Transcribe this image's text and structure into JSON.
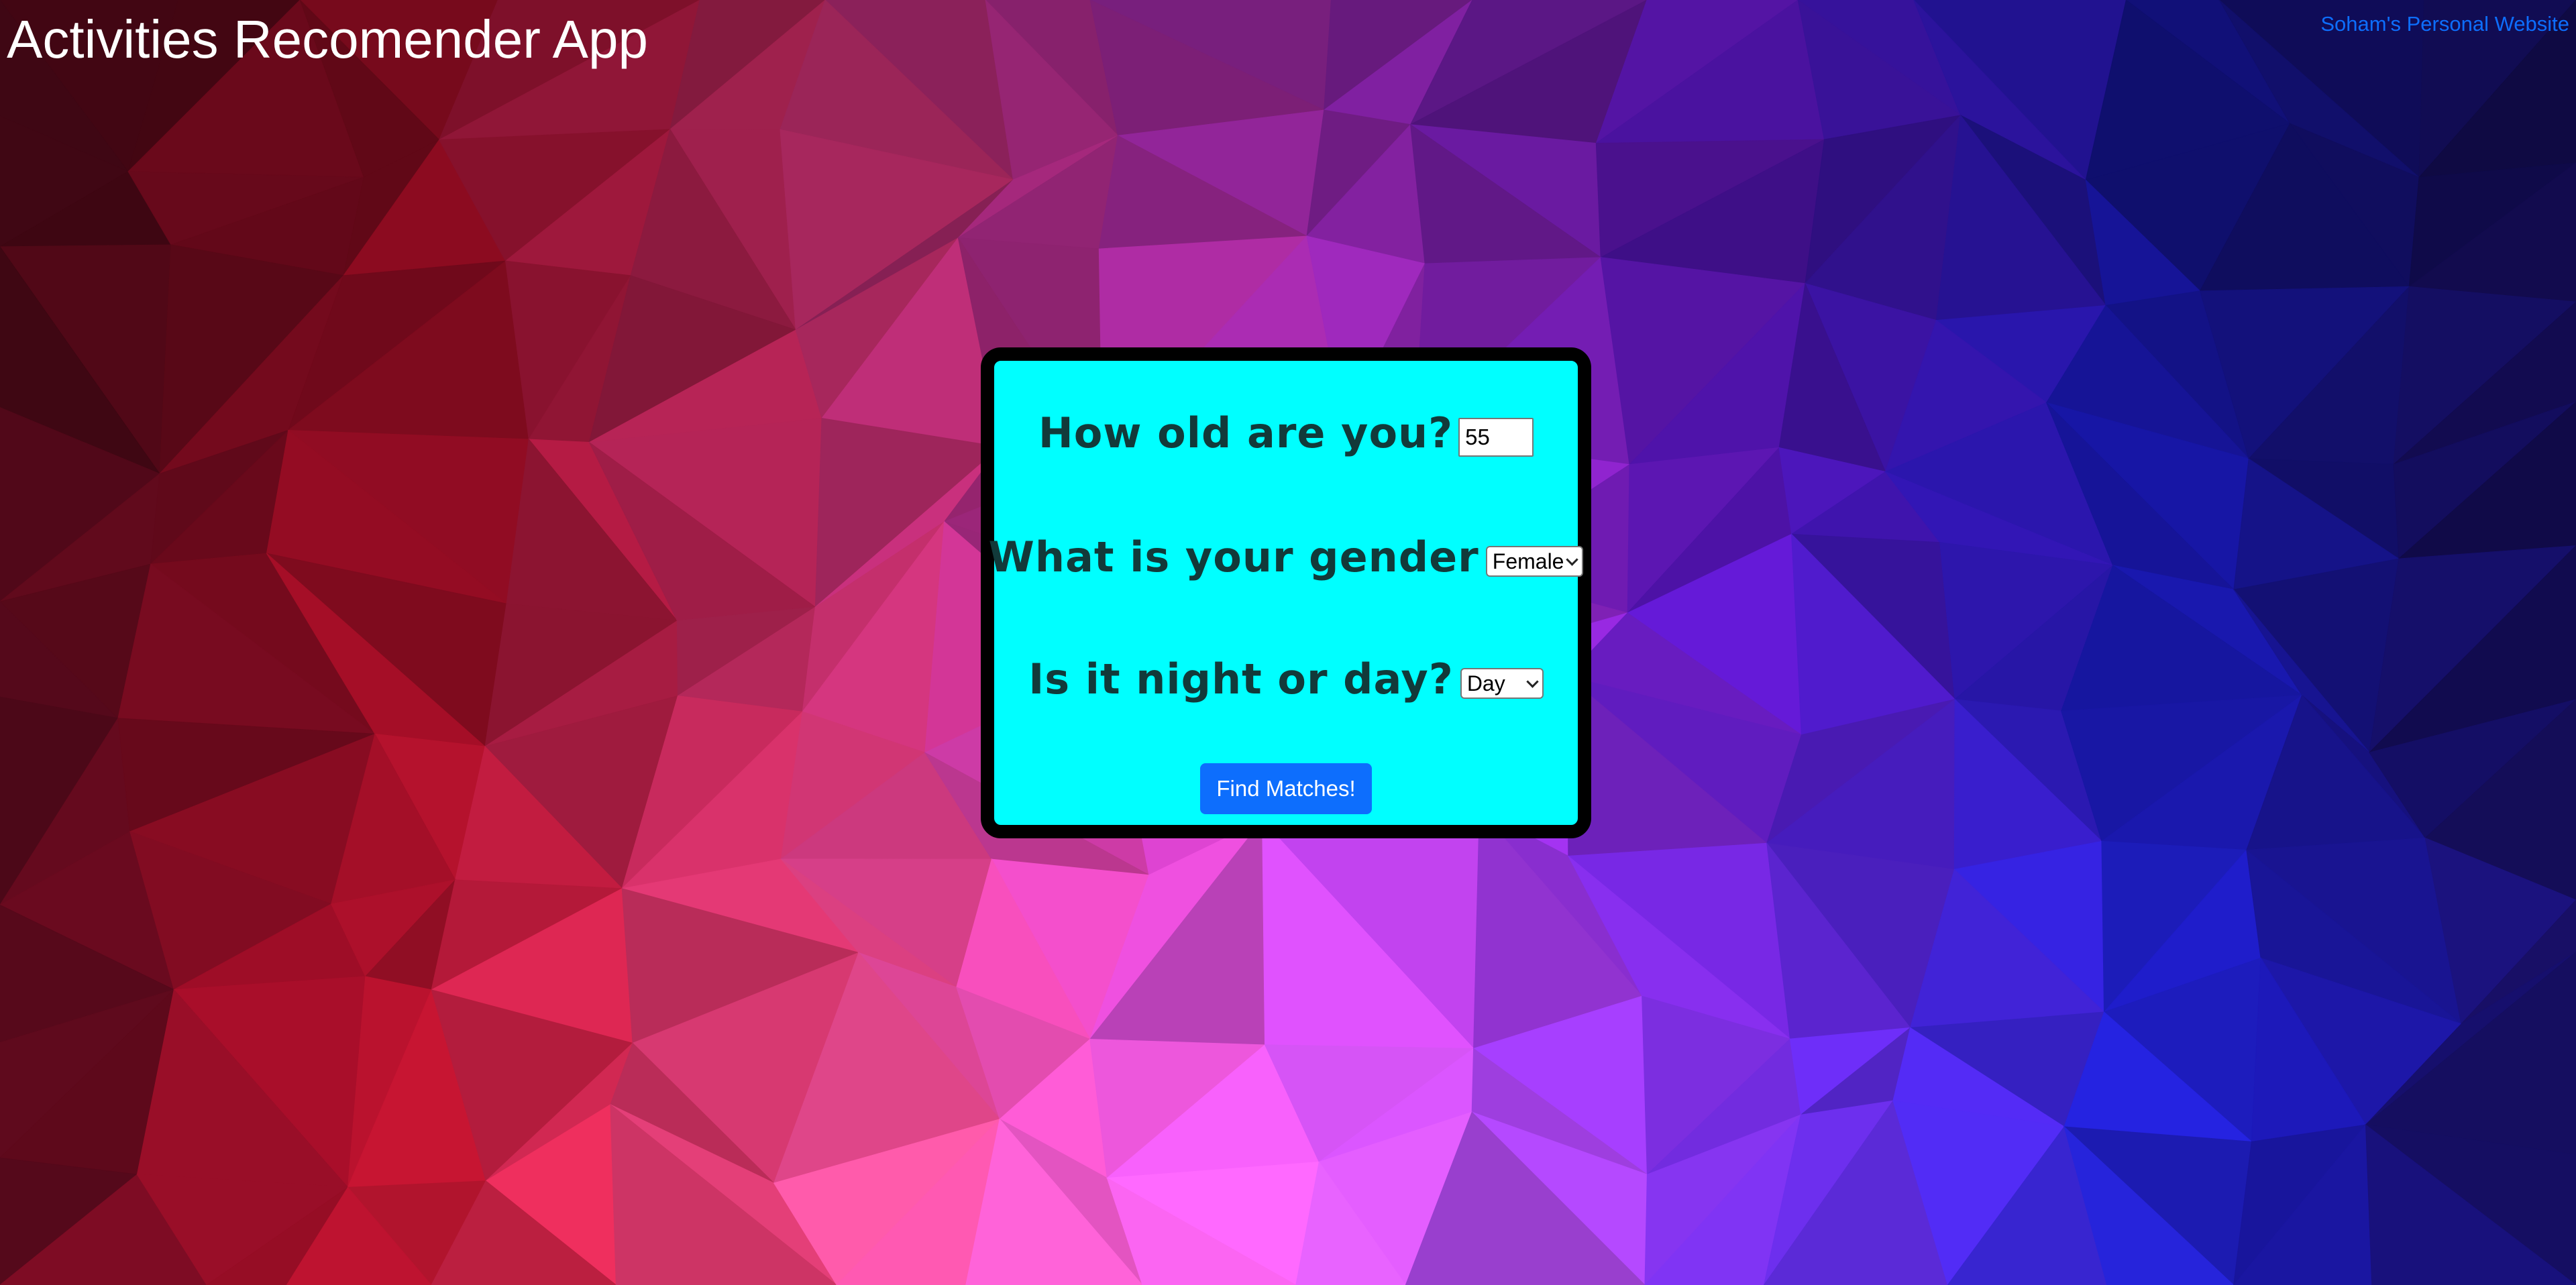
{
  "header": {
    "title": "Activities Recomender App",
    "link_label": "Soham's Personal Website"
  },
  "form": {
    "age_question": "How old are you?",
    "age_value": "55",
    "gender_question": "What is your gender",
    "gender_selected": "Female",
    "time_question": "Is it night or day?",
    "time_selected": "Day",
    "submit_label": "Find Matches!"
  },
  "colors": {
    "card_background": "#00ffff",
    "card_border": "#000000",
    "button": "#0d6efd",
    "link": "#0d6efd",
    "question_text": "#123a3a",
    "background_gradient": [
      "#5a0a1e",
      "#c8102e",
      "#ff3c8c",
      "#e83cff",
      "#7a1cff",
      "#1e1ee0",
      "#1a0f66"
    ]
  }
}
